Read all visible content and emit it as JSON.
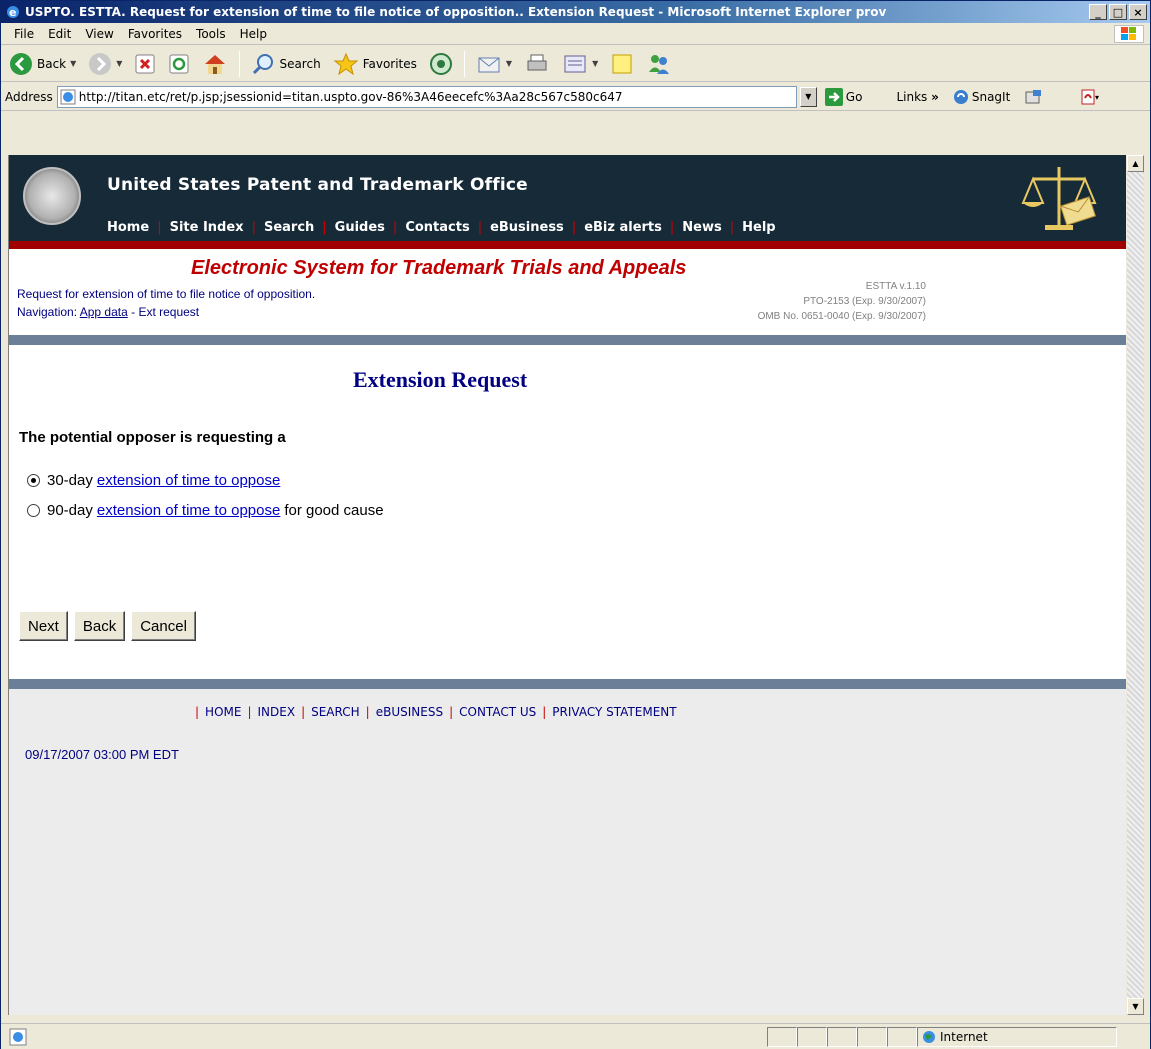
{
  "window": {
    "title": "USPTO. ESTTA. Request for extension of time to file notice of opposition.. Extension Request - Microsoft Internet Explorer prov",
    "buttons": {
      "minimize": "_",
      "maximize": "□",
      "close": "×"
    }
  },
  "menubar": {
    "items": [
      "File",
      "Edit",
      "View",
      "Favorites",
      "Tools",
      "Help"
    ]
  },
  "toolbar": {
    "back_label": "Back",
    "search_label": "Search",
    "favorites_label": "Favorites"
  },
  "addressbar": {
    "label": "Address",
    "url": "http://titan.etc/ret/p.jsp;jsessionid=titan.uspto.gov-86%3A46eecefc%3Aa28c567c580c647",
    "go_label": "Go",
    "links_label": "Links",
    "snagit_label": "SnagIt"
  },
  "uspto": {
    "title": "United States Patent and Trademark Office",
    "nav": [
      "Home",
      "Site Index",
      "Search",
      "Guides",
      "Contacts",
      "eBusiness",
      "eBiz alerts",
      "News",
      "Help"
    ]
  },
  "estta": {
    "title": "Electronic System for Trademark Trials and Appeals",
    "subtitle": "Request for extension of time to file notice of opposition.",
    "nav_prefix": "Navigation:",
    "nav_link": "App data",
    "nav_suffix": "- Ext request",
    "version": "ESTTA v.1.10",
    "pto": "PTO-2153 (Exp. 9/30/2007)",
    "omb": "OMB No. 0651-0040 (Exp. 9/30/2007)"
  },
  "main": {
    "heading": "Extension Request",
    "prompt": "The potential opposer is requesting a",
    "options": [
      {
        "prefix": "30-day",
        "link": "extension of time to oppose",
        "suffix": "",
        "selected": true
      },
      {
        "prefix": "90-day",
        "link": "extension of time to oppose",
        "suffix": "for good cause",
        "selected": false
      }
    ],
    "buttons": {
      "next": "Next",
      "back": "Back",
      "cancel": "Cancel"
    }
  },
  "footer": {
    "links": [
      "HOME",
      "INDEX",
      "SEARCH",
      "eBUSINESS",
      "CONTACT US",
      "PRIVACY STATEMENT"
    ],
    "timestamp": "09/17/2007 03:00 PM EDT"
  },
  "statusbar": {
    "zone": "Internet"
  }
}
